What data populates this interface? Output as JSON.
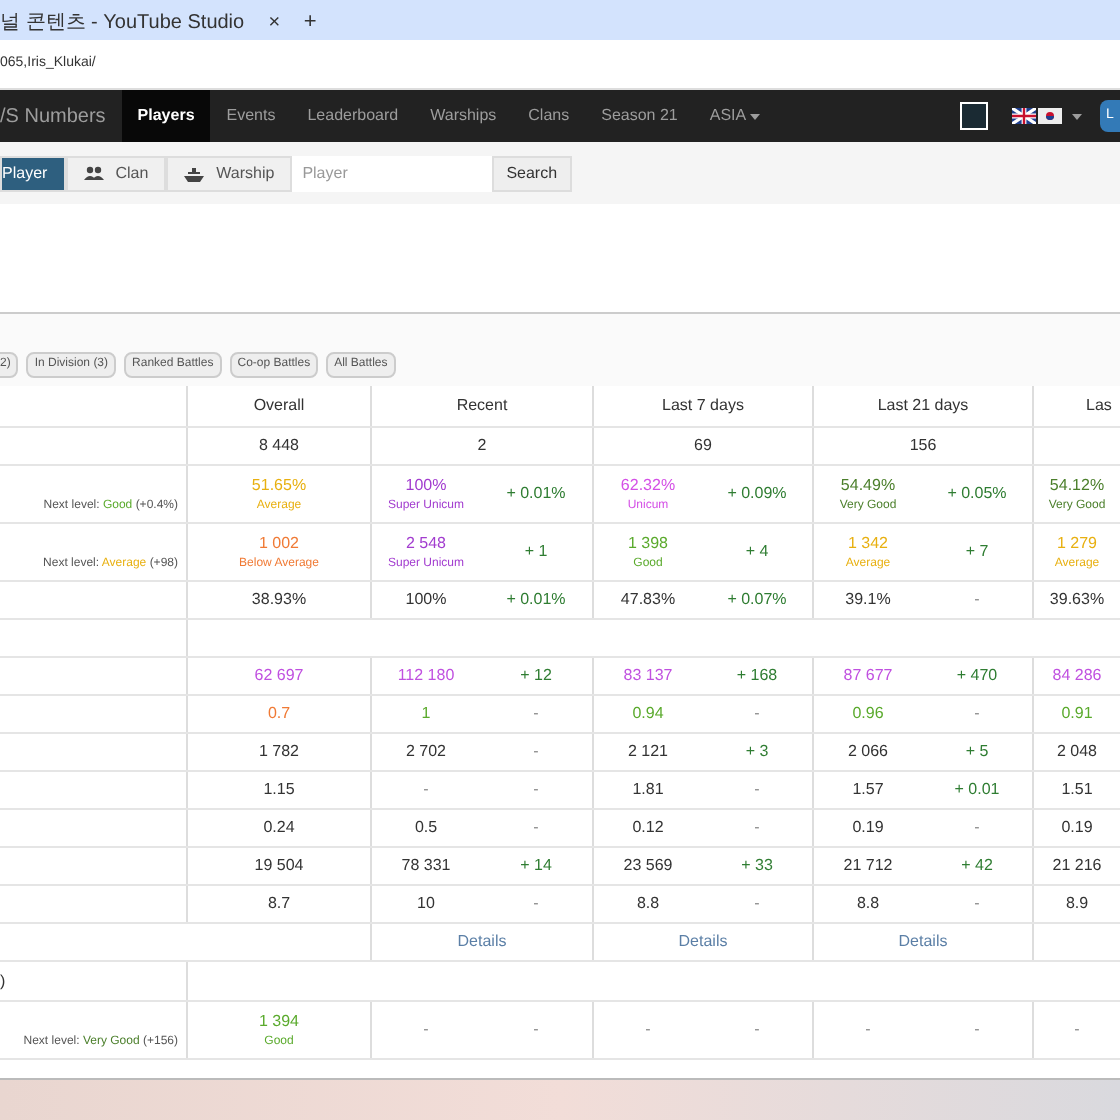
{
  "browser": {
    "tab_title": "널 콘텐츠 - YouTube Studio",
    "tab_close": "×",
    "new_tab": "+",
    "address": "065,Iris_Klukai/"
  },
  "navbar": {
    "brand": "/S Numbers",
    "items": [
      {
        "label": "Players",
        "selected": true
      },
      {
        "label": "Events",
        "selected": false
      },
      {
        "label": "Leaderboard",
        "selected": false
      },
      {
        "label": "Warships",
        "selected": false
      },
      {
        "label": "Clans",
        "selected": false
      },
      {
        "label": "Season 21",
        "selected": false
      },
      {
        "label": "ASIA",
        "selected": false,
        "kind": "dropdown"
      }
    ],
    "login": "L"
  },
  "search": {
    "tabs": [
      {
        "label": "Player",
        "selected": true,
        "kind": "plain"
      },
      {
        "label": "Clan",
        "selected": false,
        "kind": "clan"
      },
      {
        "label": "Warship",
        "selected": false,
        "kind": "ship"
      }
    ],
    "placeholder": "Player",
    "button": "Search"
  },
  "filters": [
    "2)",
    "In Division (3)",
    "Ranked Battles",
    "Co-op Battles",
    "All Battles"
  ],
  "table": {
    "columns": [
      "Overall",
      "Recent",
      "Last 7 days",
      "Last 21 days",
      "Las"
    ],
    "rows": [
      {
        "kind": "data",
        "cells": [
          {
            "kind": "value",
            "value": "8 448"
          },
          {
            "kind": "wide",
            "value": "2"
          },
          {
            "kind": "wide",
            "value": "69"
          },
          {
            "kind": "wide",
            "value": "156"
          }
        ]
      },
      {
        "kind": "data",
        "note": {
          "prefix": "Next level:",
          "rating": "Good",
          "suffix": "(+0.4%)",
          "color": "#5aaa2c"
        },
        "cells": [
          {
            "kind": "value",
            "value": "51.65%",
            "rating": "Average",
            "color": "#e8b010"
          },
          {
            "kind": "value",
            "value": "100%",
            "rating": "Super Unicum",
            "color": "#a23ccf"
          },
          {
            "kind": "value",
            "value": "+ 0.01%",
            "color": "#2f7d32"
          },
          {
            "kind": "value",
            "value": "62.32%",
            "rating": "Unicum",
            "color": "#d44fe6"
          },
          {
            "kind": "value",
            "value": "+ 0.09%",
            "color": "#2f7d32"
          },
          {
            "kind": "value",
            "value": "54.49%",
            "rating": "Very Good",
            "color": "#4b7f2b"
          },
          {
            "kind": "value",
            "value": "+ 0.05%",
            "color": "#2f7d32"
          },
          {
            "kind": "value",
            "value": "54.12%",
            "rating": "Very Good",
            "color": "#4b7f2b"
          }
        ]
      },
      {
        "kind": "data",
        "note": {
          "prefix": "Next level:",
          "rating": "Average",
          "suffix": "(+98)",
          "color": "#e8b010"
        },
        "cells": [
          {
            "kind": "value",
            "value": "1 002",
            "rating": "Below Average",
            "color": "#f07a35"
          },
          {
            "kind": "value",
            "value": "2 548",
            "rating": "Super Unicum",
            "color": "#a23ccf"
          },
          {
            "kind": "value",
            "value": "+ 1",
            "color": "#2f7d32"
          },
          {
            "kind": "value",
            "value": "1 398",
            "rating": "Good",
            "color": "#5aaa2c"
          },
          {
            "kind": "value",
            "value": "+ 4",
            "color": "#2f7d32"
          },
          {
            "kind": "value",
            "value": "1 342",
            "rating": "Average",
            "color": "#e8b010"
          },
          {
            "kind": "value",
            "value": "+ 7",
            "color": "#2f7d32"
          },
          {
            "kind": "value",
            "value": "1 279",
            "rating": "Average",
            "color": "#e8b010"
          }
        ]
      },
      {
        "kind": "data",
        "cells": [
          {
            "kind": "value",
            "value": "38.93%"
          },
          {
            "kind": "value",
            "value": "100%"
          },
          {
            "kind": "value",
            "value": "+ 0.01%",
            "color": "#2f7d32"
          },
          {
            "kind": "value",
            "value": "47.83%"
          },
          {
            "kind": "value",
            "value": "+ 0.07%",
            "color": "#2f7d32"
          },
          {
            "kind": "value",
            "value": "39.1%"
          },
          {
            "kind": "value",
            "value": "-"
          },
          {
            "kind": "value",
            "value": "39.63%"
          }
        ]
      },
      {
        "kind": "blank"
      },
      {
        "kind": "data",
        "cells": [
          {
            "kind": "value",
            "value": "62 697",
            "color": "#c050e0"
          },
          {
            "kind": "value",
            "value": "112 180",
            "color": "#c050e0"
          },
          {
            "kind": "value",
            "value": "+ 12",
            "color": "#2f7d32"
          },
          {
            "kind": "value",
            "value": "83 137",
            "color": "#c050e0"
          },
          {
            "kind": "value",
            "value": "+ 168",
            "color": "#2f7d32"
          },
          {
            "kind": "value",
            "value": "87 677",
            "color": "#c050e0"
          },
          {
            "kind": "value",
            "value": "+ 470",
            "color": "#2f7d32"
          },
          {
            "kind": "value",
            "value": "84 286",
            "color": "#c050e0"
          }
        ]
      },
      {
        "kind": "data",
        "cells": [
          {
            "kind": "value",
            "value": "0.7",
            "color": "#f07a35"
          },
          {
            "kind": "value",
            "value": "1",
            "color": "#5aaa2c"
          },
          {
            "kind": "value",
            "value": "-"
          },
          {
            "kind": "value",
            "value": "0.94",
            "color": "#5aaa2c"
          },
          {
            "kind": "value",
            "value": "-"
          },
          {
            "kind": "value",
            "value": "0.96",
            "color": "#5aaa2c"
          },
          {
            "kind": "value",
            "value": "-"
          },
          {
            "kind": "value",
            "value": "0.91",
            "color": "#5aaa2c"
          }
        ]
      },
      {
        "kind": "data",
        "cells": [
          {
            "kind": "value",
            "value": "1 782"
          },
          {
            "kind": "value",
            "value": "2 702"
          },
          {
            "kind": "value",
            "value": "-"
          },
          {
            "kind": "value",
            "value": "2 121"
          },
          {
            "kind": "value",
            "value": "+ 3",
            "color": "#2f7d32"
          },
          {
            "kind": "value",
            "value": "2 066"
          },
          {
            "kind": "value",
            "value": "+ 5",
            "color": "#2f7d32"
          },
          {
            "kind": "value",
            "value": "2 048"
          }
        ]
      },
      {
        "kind": "data",
        "cells": [
          {
            "kind": "value",
            "value": "1.15"
          },
          {
            "kind": "value",
            "value": "-"
          },
          {
            "kind": "value",
            "value": "-"
          },
          {
            "kind": "value",
            "value": "1.81"
          },
          {
            "kind": "value",
            "value": "-"
          },
          {
            "kind": "value",
            "value": "1.57"
          },
          {
            "kind": "value",
            "value": "+ 0.01",
            "color": "#2f7d32"
          },
          {
            "kind": "value",
            "value": "1.51"
          }
        ]
      },
      {
        "kind": "data",
        "cells": [
          {
            "kind": "value",
            "value": "0.24"
          },
          {
            "kind": "value",
            "value": "0.5"
          },
          {
            "kind": "value",
            "value": "-"
          },
          {
            "kind": "value",
            "value": "0.12"
          },
          {
            "kind": "value",
            "value": "-"
          },
          {
            "kind": "value",
            "value": "0.19"
          },
          {
            "kind": "value",
            "value": "-"
          },
          {
            "kind": "value",
            "value": "0.19"
          }
        ]
      },
      {
        "kind": "data",
        "cells": [
          {
            "kind": "value",
            "value": "19 504"
          },
          {
            "kind": "value",
            "value": "78 331"
          },
          {
            "kind": "value",
            "value": "+ 14",
            "color": "#2f7d32"
          },
          {
            "kind": "value",
            "value": "23 569"
          },
          {
            "kind": "value",
            "value": "+ 33",
            "color": "#2f7d32"
          },
          {
            "kind": "value",
            "value": "21 712"
          },
          {
            "kind": "value",
            "value": "+ 42",
            "color": "#2f7d32"
          },
          {
            "kind": "value",
            "value": "21 216"
          }
        ]
      },
      {
        "kind": "data",
        "cells": [
          {
            "kind": "value",
            "value": "8.7"
          },
          {
            "kind": "value",
            "value": "10"
          },
          {
            "kind": "value",
            "value": "-"
          },
          {
            "kind": "value",
            "value": "8.8"
          },
          {
            "kind": "value",
            "value": "-"
          },
          {
            "kind": "value",
            "value": "8.8"
          },
          {
            "kind": "value",
            "value": "-"
          },
          {
            "kind": "value",
            "value": "8.9"
          }
        ]
      },
      {
        "kind": "links",
        "links": [
          "Details",
          "Details",
          "Details"
        ]
      },
      {
        "kind": "section",
        "label": ")"
      },
      {
        "kind": "data",
        "note": {
          "prefix": "Next level:",
          "rating": "Very Good",
          "suffix": "(+156)",
          "color": "#4b7f2b"
        },
        "cells": [
          {
            "kind": "value",
            "value": "1 394",
            "rating": "Good",
            "color": "#5aaa2c"
          },
          {
            "kind": "value",
            "value": "-"
          },
          {
            "kind": "value",
            "value": "-"
          },
          {
            "kind": "value",
            "value": "-"
          },
          {
            "kind": "value",
            "value": "-"
          },
          {
            "kind": "value",
            "value": "-"
          },
          {
            "kind": "value",
            "value": "-"
          },
          {
            "kind": "value",
            "value": "-"
          }
        ]
      }
    ]
  }
}
